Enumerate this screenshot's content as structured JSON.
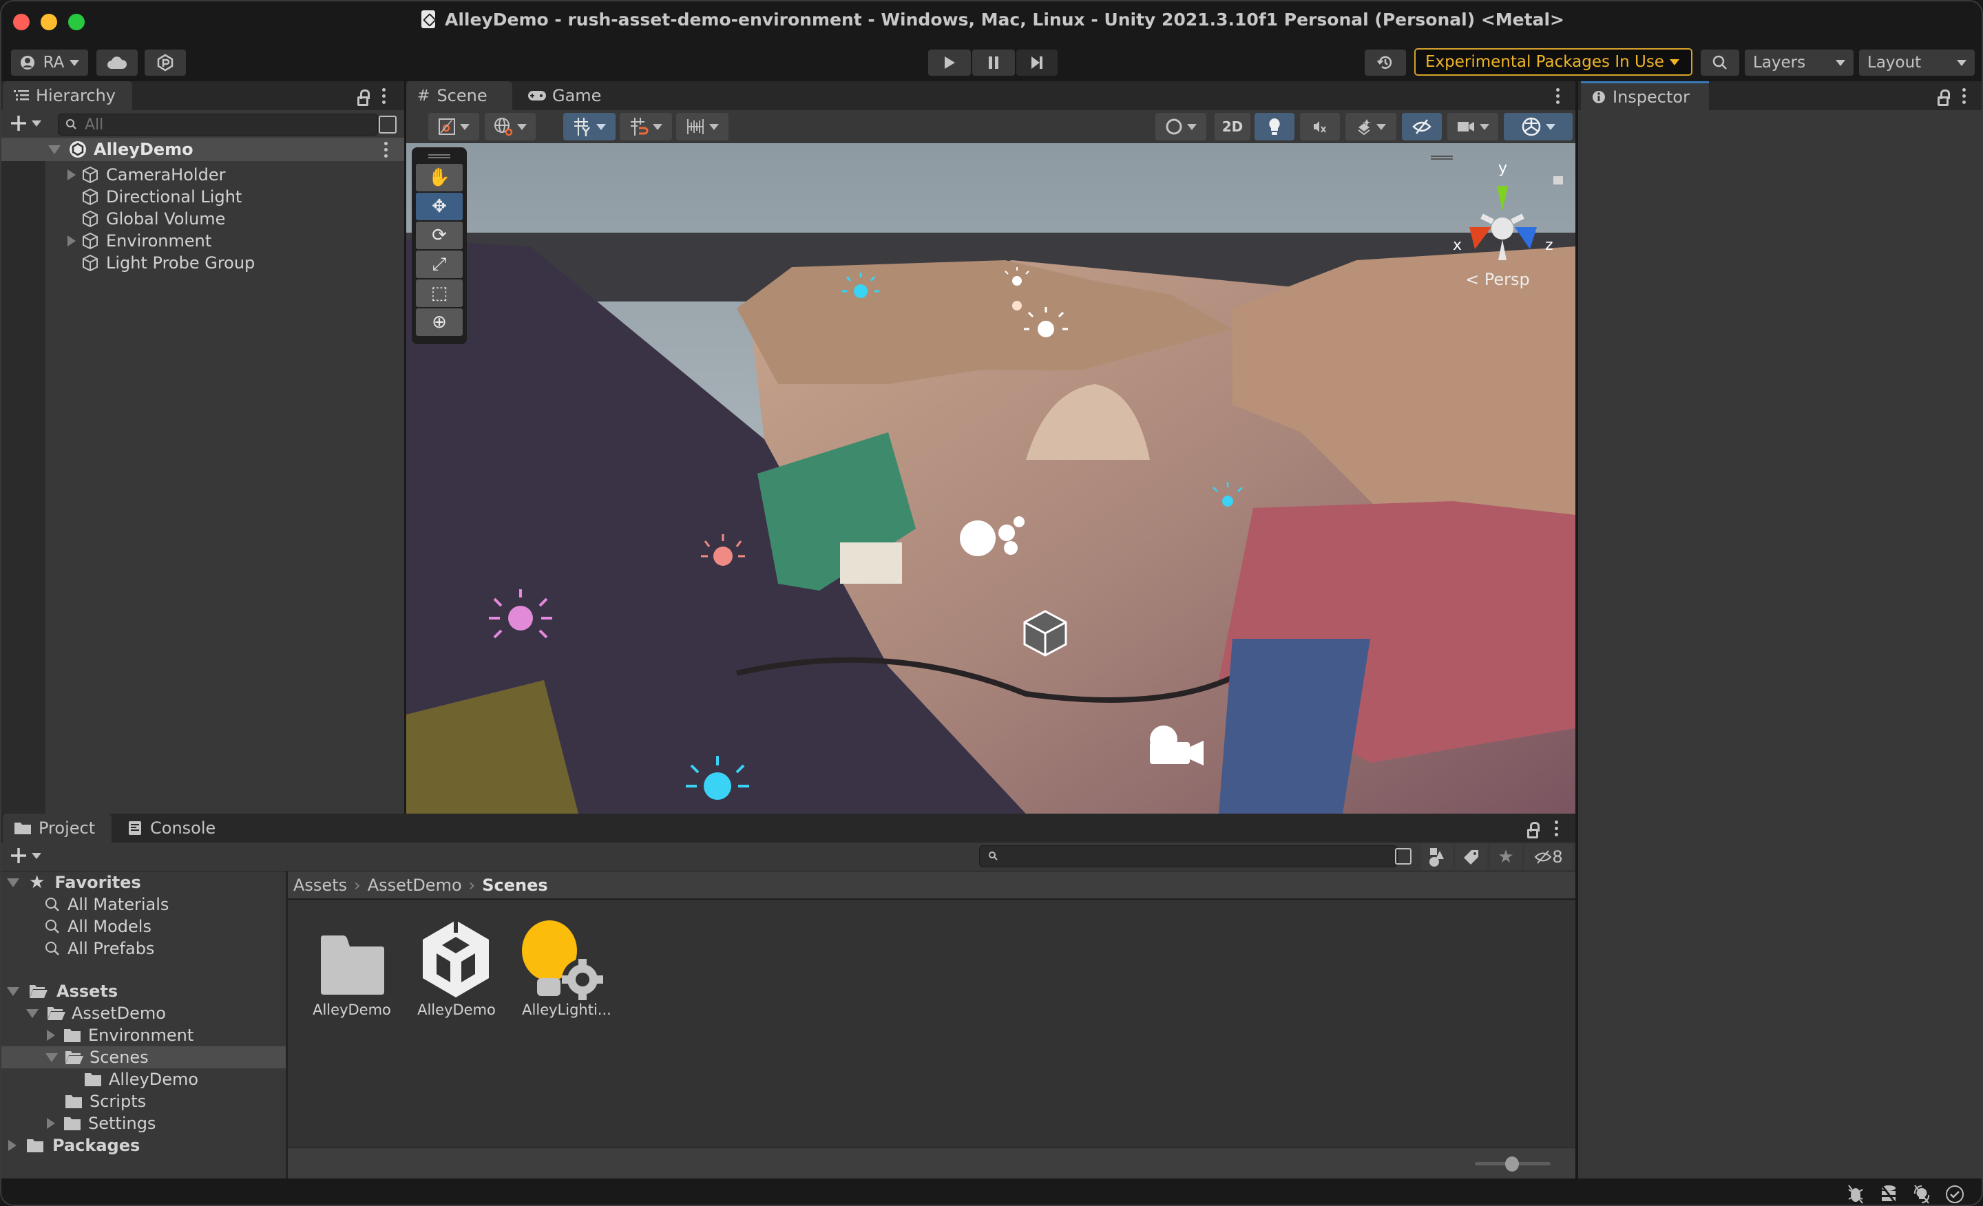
{
  "window": {
    "title": "AlleyDemo - rush-asset-demo-environment - Windows, Mac, Linux - Unity 2021.3.10f1 Personal (Personal) <Metal>",
    "traffic_colors": {
      "close": "#ff5f57",
      "minimize": "#febc2e",
      "zoom": "#28c840"
    }
  },
  "toolbar": {
    "account_label": "RA",
    "account_icon": "person-icon",
    "cloud_icon": "cloud-icon",
    "collab_icon": "plastic-scm-icon",
    "play_icon": "play-icon",
    "pause_icon": "pause-icon",
    "step_icon": "step-icon",
    "history_icon": "undo-history-icon",
    "experimental_label": "Experimental Packages In Use",
    "experimental_color": "#f0b429",
    "search_icon": "search-icon",
    "layers_label": "Layers",
    "layout_label": "Layout"
  },
  "hierarchy": {
    "tab_label": "Hierarchy",
    "search_placeholder": "All",
    "scene_name": "AlleyDemo",
    "items": [
      {
        "label": "CameraHolder",
        "expandable": true
      },
      {
        "label": "Directional Light",
        "expandable": false
      },
      {
        "label": "Global Volume",
        "expandable": false
      },
      {
        "label": "Environment",
        "expandable": true
      },
      {
        "label": "Light Probe Group",
        "expandable": false
      }
    ]
  },
  "scene": {
    "tabs": [
      {
        "label": "Scene",
        "icon": "grid-icon",
        "active": true
      },
      {
        "label": "Game",
        "icon": "gamepad-icon",
        "active": false
      }
    ],
    "toolbar": {
      "two_d_label": "2D"
    },
    "tools": [
      "hand-tool",
      "move-tool",
      "rotate-tool",
      "scale-tool",
      "rect-tool",
      "transform-tool"
    ],
    "active_tool": "move-tool",
    "gizmo": {
      "x_label": "x",
      "y_label": "y",
      "z_label": "z",
      "projection_label": "Persp"
    }
  },
  "inspector": {
    "tab_label": "Inspector"
  },
  "project": {
    "tabs": [
      {
        "label": "Project",
        "icon": "folder-icon",
        "active": true
      },
      {
        "label": "Console",
        "icon": "console-icon",
        "active": false
      }
    ],
    "favorites_label": "Favorites",
    "favorites": [
      "All Materials",
      "All Models",
      "All Prefabs"
    ],
    "assets_label": "Assets",
    "tree": [
      {
        "label": "AssetDemo",
        "level": 1,
        "state": "expanded",
        "icon": "folder-open-icon"
      },
      {
        "label": "Environment",
        "level": 2,
        "state": "collapsed",
        "icon": "folder-icon"
      },
      {
        "label": "Scenes",
        "level": 2,
        "state": "expanded",
        "icon": "folder-open-icon",
        "selected": true
      },
      {
        "label": "AlleyDemo",
        "level": 3,
        "state": "leaf",
        "icon": "folder-icon"
      },
      {
        "label": "Scripts",
        "level": 2,
        "state": "leaf",
        "icon": "folder-icon"
      },
      {
        "label": "Settings",
        "level": 2,
        "state": "collapsed",
        "icon": "folder-icon"
      }
    ],
    "packages_label": "Packages",
    "breadcrumb": [
      "Assets",
      "AssetDemo",
      "Scenes"
    ],
    "assets": [
      {
        "label": "AlleyDemo",
        "type": "folder"
      },
      {
        "label": "AlleyDemo",
        "type": "scene"
      },
      {
        "label": "AlleyLighti...",
        "type": "lighting-settings"
      }
    ],
    "hidden_count": "8",
    "zoom_slider_value": 0.5
  },
  "statusbar": {
    "icons": [
      "debug-off-icon",
      "cache-server-off-icon",
      "auto-generate-lighting-off-icon",
      "progress-check-icon"
    ]
  }
}
